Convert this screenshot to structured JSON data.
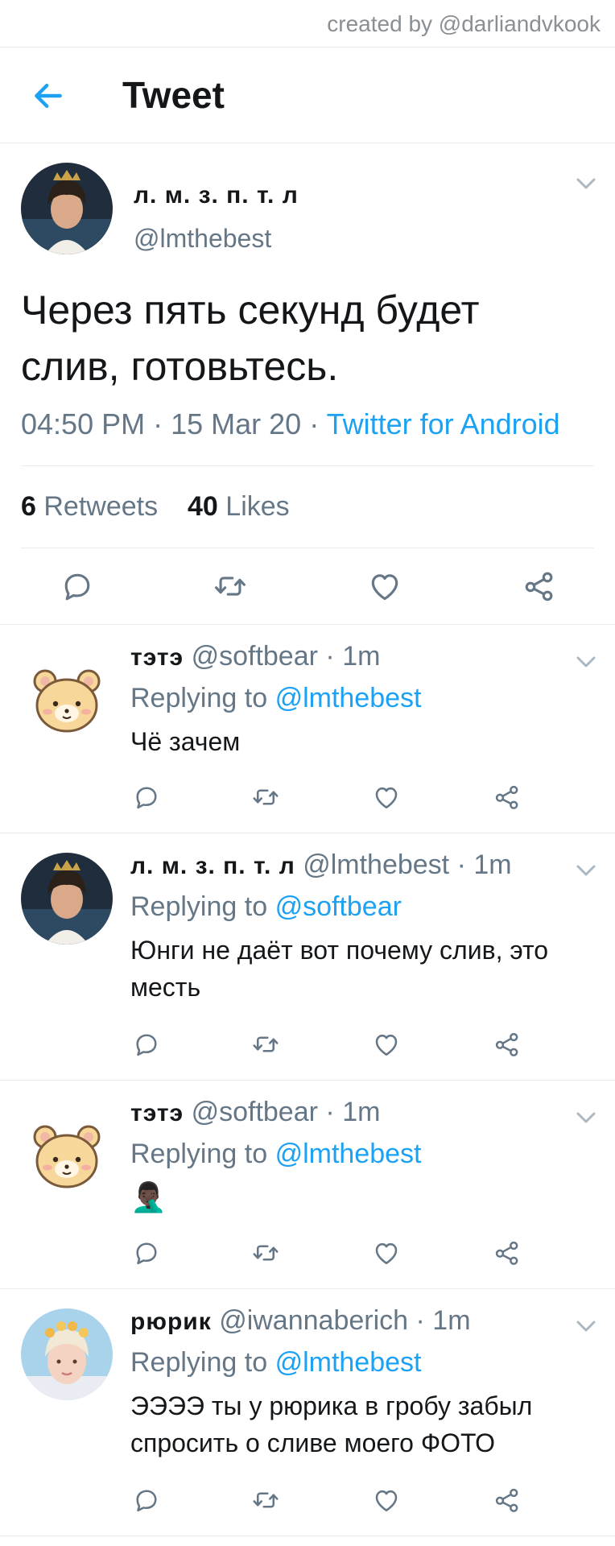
{
  "credit": "created by @darliandvkook",
  "header": {
    "title": "Tweet"
  },
  "icons": {
    "back": "arrow-left-icon",
    "chevron": "chevron-down-icon",
    "reply": "reply-icon",
    "retweet": "retweet-icon",
    "like": "heart-icon",
    "share": "share-icon"
  },
  "colors": {
    "accent": "#1da1f2",
    "secondary_text": "#657786",
    "divider": "#e6ecf0"
  },
  "tweet": {
    "author_name": "л. м. з. п. т. л",
    "author_handle": "@lmthebest",
    "text": "Через пять секунд будет слив, готовьтесь.",
    "time": "04:50 PM",
    "date": "15 Mar 20",
    "source": "Twitter for Android",
    "retweets_count": "6",
    "retweets_label": "Retweets",
    "likes_count": "40",
    "likes_label": "Likes"
  },
  "replies": [
    {
      "name": "тэтэ",
      "handle": "@softbear",
      "time": "1m",
      "replying_label": "Replying to",
      "replying_to": "@lmthebest",
      "text": "Чё зачем"
    },
    {
      "name": "л. м. з. п. т. л",
      "handle": "@lmthebest",
      "time": "1m",
      "replying_label": "Replying to",
      "replying_to": "@softbear",
      "text": "Юнги не даёт вот почему слив, это месть"
    },
    {
      "name": "тэтэ",
      "handle": "@softbear",
      "time": "1m",
      "replying_label": "Replying to",
      "replying_to": "@lmthebest",
      "text": "🤦🏿‍♂️"
    },
    {
      "name": "рюрик",
      "handle": "@iwannaberich",
      "time": "1m",
      "replying_label": "Replying to",
      "replying_to": "@lmthebest",
      "text": "ЭЭЭЭ ты у рюрика в гробу забыл спросить о сливе моего ФОТО"
    }
  ]
}
